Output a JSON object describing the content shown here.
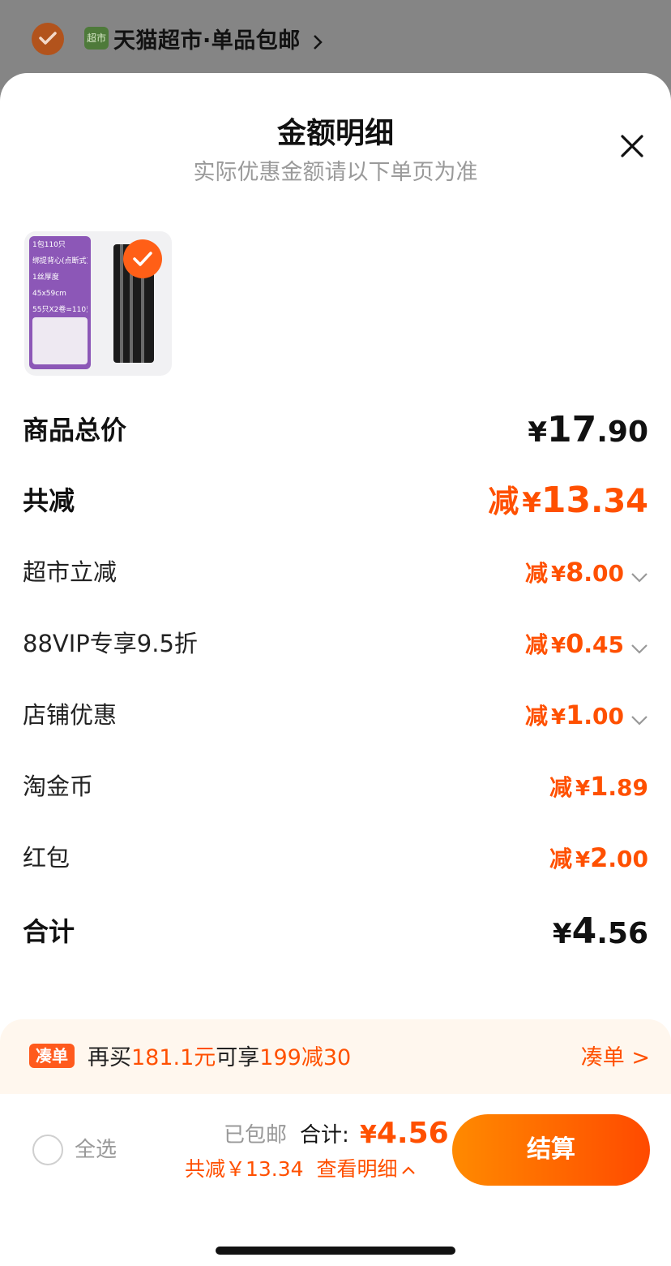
{
  "background": {
    "store_name": "天猫超市·单品包邮",
    "store_logo_text": "超市"
  },
  "sheet": {
    "title": "金额明细",
    "subtitle": "实际优惠金额请以下单页为准",
    "close_icon": "close-icon"
  },
  "product": {
    "thumb_lines": [
      "1包110只",
      "绑提背心(点断式)",
      "1丝厚度",
      "45x59cm",
      "55只X2卷=110只"
    ],
    "selected": true
  },
  "breakdown": {
    "total_price": {
      "label": "商品总价",
      "currency": "¥",
      "int": "17",
      "dec": ".90"
    },
    "total_discount": {
      "label": "共减",
      "prefix": "减",
      "currency": "¥",
      "int": "13",
      "dec": ".34"
    },
    "items": [
      {
        "label": "超市立减",
        "prefix": "减",
        "currency": "¥",
        "int": "8",
        "dec": ".00",
        "expandable": true
      },
      {
        "label": "88VIP专享9.5折",
        "prefix": "减",
        "currency": "¥",
        "int": "0",
        "dec": ".45",
        "expandable": true
      },
      {
        "label": "店铺优惠",
        "prefix": "减",
        "currency": "¥",
        "int": "1",
        "dec": ".00",
        "expandable": true
      },
      {
        "label": "淘金币",
        "prefix": "减",
        "currency": "¥",
        "int": "1",
        "dec": ".89",
        "expandable": false
      },
      {
        "label": "红包",
        "prefix": "减",
        "currency": "¥",
        "int": "2",
        "dec": ".00",
        "expandable": false
      }
    ],
    "grand_total": {
      "label": "合计",
      "currency": "¥",
      "int": "4",
      "dec": ".56"
    }
  },
  "promo": {
    "tag": "凑单",
    "text_a": "再买",
    "text_b": "181.1元",
    "text_c": "可享",
    "text_d": "199减30",
    "link": "凑单 >"
  },
  "footer": {
    "select_all": "全选",
    "shipping": "已包邮",
    "total_label": "合计:",
    "total_currency": "¥",
    "total_value": "4.56",
    "saving": "共减￥13.34",
    "detail_link": "查看明细",
    "checkout": "结算"
  },
  "colors": {
    "accent": "#ff5000",
    "checkout_gradient_start": "#ff8a00",
    "checkout_gradient_end": "#ff4a00"
  }
}
